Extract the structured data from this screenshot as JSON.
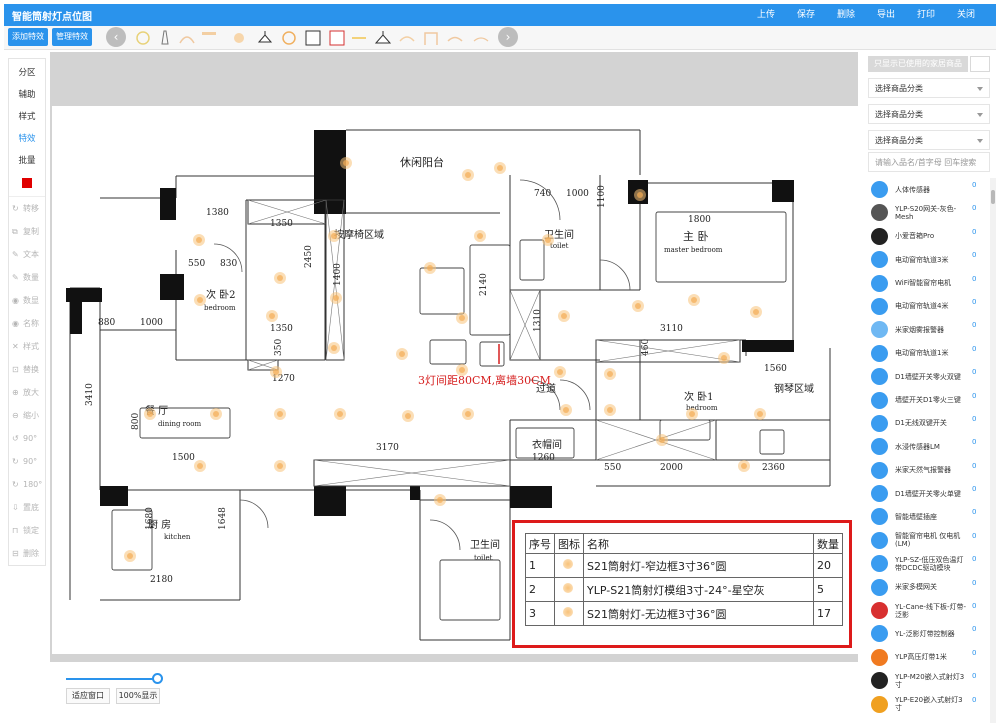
{
  "app": {
    "title": "智能筒射灯点位图"
  },
  "header_menu": [
    "上传",
    "保存",
    "删除",
    "导出",
    "打印",
    "关闭"
  ],
  "toolbar": {
    "add_effect": "添加特效",
    "manage_effect": "管理特效",
    "prev_icon": "chevron-left-icon",
    "next_icon": "chevron-right-icon"
  },
  "left_panel": {
    "items": [
      "分区",
      "辅助",
      "样式",
      "特效",
      "批量"
    ],
    "active": "特效",
    "swatch_color": "#e00000",
    "tools": [
      {
        "label": "转移",
        "icon": "↻"
      },
      {
        "label": "复制",
        "icon": "⧉"
      },
      {
        "label": "文本",
        "icon": "✎"
      },
      {
        "label": "数量",
        "icon": "✎"
      },
      {
        "label": "数显",
        "icon": "◉"
      },
      {
        "label": "名称",
        "icon": "◉"
      },
      {
        "label": "样式",
        "icon": "✕"
      },
      {
        "label": "替换",
        "icon": "⊡"
      },
      {
        "label": "放大",
        "icon": "⊕"
      },
      {
        "label": "缩小",
        "icon": "⊖"
      },
      {
        "label": "90°",
        "icon": "↺"
      },
      {
        "label": "90°",
        "icon": "↻"
      },
      {
        "label": "180°",
        "icon": "↻"
      },
      {
        "label": "置底",
        "icon": "⇩"
      },
      {
        "label": "锁定",
        "icon": "⊓"
      },
      {
        "label": "删除",
        "icon": "⊟"
      }
    ]
  },
  "floorplan": {
    "rooms": [
      "休闲阳台",
      "按摩椅区域",
      "卫生间",
      "toilet",
      "主 卧",
      "master bedroom",
      "次 卧2",
      "bedroom",
      "餐 厅",
      "dining room",
      "过道",
      "次 卧1",
      "bedroom",
      "钢琴区域",
      "衣帽间",
      "厨 房",
      "kitchen",
      "卫生间",
      "toilet"
    ],
    "dimensions": [
      "1380",
      "1350",
      "550",
      "830",
      "880",
      "1000",
      "3410",
      "1350",
      "1270",
      "350",
      "2450",
      "1400",
      "2140",
      "740",
      "1100",
      "1000",
      "1800",
      "3110",
      "460",
      "1310",
      "1560",
      "800",
      "1500",
      "3170",
      "1260",
      "550",
      "2000",
      "2360",
      "1680",
      "1648",
      "2180"
    ],
    "note": "3灯间距80CM,离墙30CM"
  },
  "legend": {
    "headers": [
      "序号",
      "图标",
      "名称",
      "数量"
    ],
    "rows": [
      {
        "no": "1",
        "name": "S21筒射灯-窄边框3寸36°圆",
        "qty": "20"
      },
      {
        "no": "2",
        "name": "YLP-S21筒射灯模组3寸-24°-星空灰",
        "qty": "5"
      },
      {
        "no": "3",
        "name": "S21筒射灯-无边框3寸36°圆",
        "qty": "17"
      }
    ]
  },
  "bottom": {
    "fit_window": "适应窗口",
    "show_100": "100%显示",
    "zoom_fraction": 0.95
  },
  "right_panel": {
    "only_used_label": "只显示已使用的家居商品",
    "category_selects": [
      "选择商品分类",
      "选择商品分类",
      "选择商品分类"
    ],
    "search_placeholder": "请输入品名/首字母 回车搜索",
    "products": [
      {
        "name": "人体传感器",
        "count": "0",
        "color": "#3a9cf0"
      },
      {
        "name": "YLP-S20网关-灰色-Mesh",
        "count": "0",
        "color": "#555555"
      },
      {
        "name": "小爱音箱Pro",
        "count": "0",
        "color": "#222222"
      },
      {
        "name": "电动窗帘轨道3米",
        "count": "0",
        "color": "#3a9cf0"
      },
      {
        "name": "WiFi智能窗帘电机",
        "count": "0",
        "color": "#3a9cf0"
      },
      {
        "name": "电动窗帘轨道4米",
        "count": "0",
        "color": "#3a9cf0"
      },
      {
        "name": "米家烟雾报警器",
        "count": "0",
        "color": "#6fb8f3"
      },
      {
        "name": "电动窗帘轨道1米",
        "count": "0",
        "color": "#3a9cf0"
      },
      {
        "name": "D1墙壁开关零火双键",
        "count": "0",
        "color": "#3a9cf0"
      },
      {
        "name": "墙壁开关D1零火三键",
        "count": "0",
        "color": "#3a9cf0"
      },
      {
        "name": "D1无线双键开关",
        "count": "0",
        "color": "#3a9cf0"
      },
      {
        "name": "水浸传感器LM",
        "count": "0",
        "color": "#3a9cf0"
      },
      {
        "name": "米家天然气报警器",
        "count": "0",
        "color": "#3a9cf0"
      },
      {
        "name": "D1墙壁开关零火单键",
        "count": "0",
        "color": "#3a9cf0"
      },
      {
        "name": "智能墙壁插座",
        "count": "0",
        "color": "#3a9cf0"
      },
      {
        "name": "智能窗帘电机 仅电机 (LM)",
        "count": "0",
        "color": "#3a9cf0"
      },
      {
        "name": "YLP-SZ-低压双色温灯带DCDC驱动模块",
        "count": "0",
        "color": "#3a9cf0"
      },
      {
        "name": "米家多模网关",
        "count": "0",
        "color": "#3a9cf0"
      },
      {
        "name": "YL-Cane-线下板-灯带-泛影",
        "count": "0",
        "color": "#d83030"
      },
      {
        "name": "YL-泛影灯带控制器",
        "count": "0",
        "color": "#3a9cf0"
      },
      {
        "name": "YLP高压灯带1米",
        "count": "0",
        "color": "#f07a20"
      },
      {
        "name": "YLP-M20嵌入式射灯3寸",
        "count": "0",
        "color": "#222222"
      },
      {
        "name": "YLP-E20嵌入式射灯3寸",
        "count": "0",
        "color": "#f0a020"
      }
    ]
  }
}
